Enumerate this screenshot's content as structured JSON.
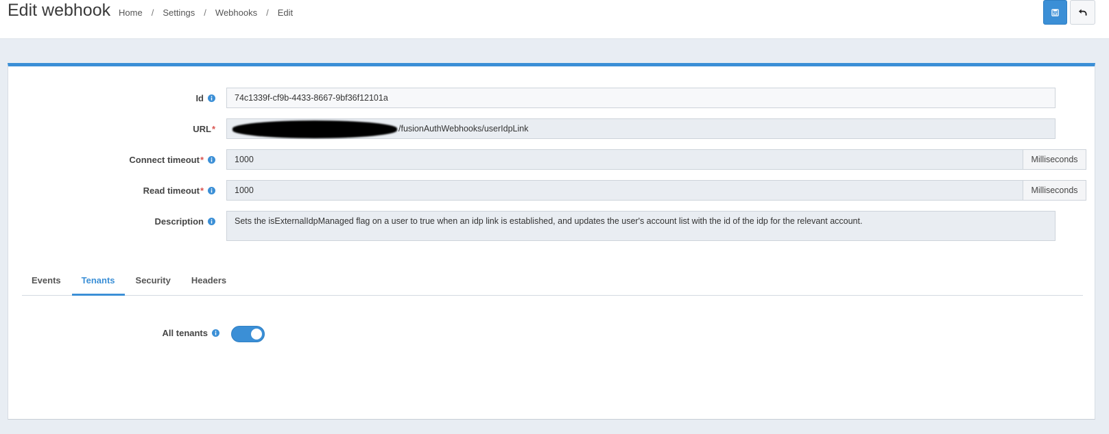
{
  "header": {
    "title": "Edit webhook",
    "breadcrumb": [
      "Home",
      "Settings",
      "Webhooks",
      "Edit"
    ],
    "separator": "/"
  },
  "form": {
    "id": {
      "label": "Id",
      "value": "74c1339f-cf9b-4433-8667-9bf36f12101a"
    },
    "url": {
      "label": "URL",
      "required": "*",
      "value_suffix": "/fusionAuthWebhooks/userIdpLink"
    },
    "connect_timeout": {
      "label": "Connect timeout",
      "required": "*",
      "value": "1000",
      "unit": "Milliseconds"
    },
    "read_timeout": {
      "label": "Read timeout",
      "required": "*",
      "value": "1000",
      "unit": "Milliseconds"
    },
    "description": {
      "label": "Description",
      "value": "Sets the isExternalIdpManaged flag on a user to true when an idp link is established, and updates the user's account list with the id of the idp for the relevant account."
    }
  },
  "tabs": [
    {
      "label": "Events",
      "active": false
    },
    {
      "label": "Tenants",
      "active": true
    },
    {
      "label": "Security",
      "active": false
    },
    {
      "label": "Headers",
      "active": false
    }
  ],
  "tenants": {
    "all_tenants_label": "All tenants",
    "all_tenants_enabled": true
  },
  "colors": {
    "accent": "#3b8fd6",
    "required": "#d9534f",
    "background": "#e8edf3"
  },
  "icons": {
    "save": "save-icon",
    "back": "undo-icon",
    "info": "info-icon"
  }
}
